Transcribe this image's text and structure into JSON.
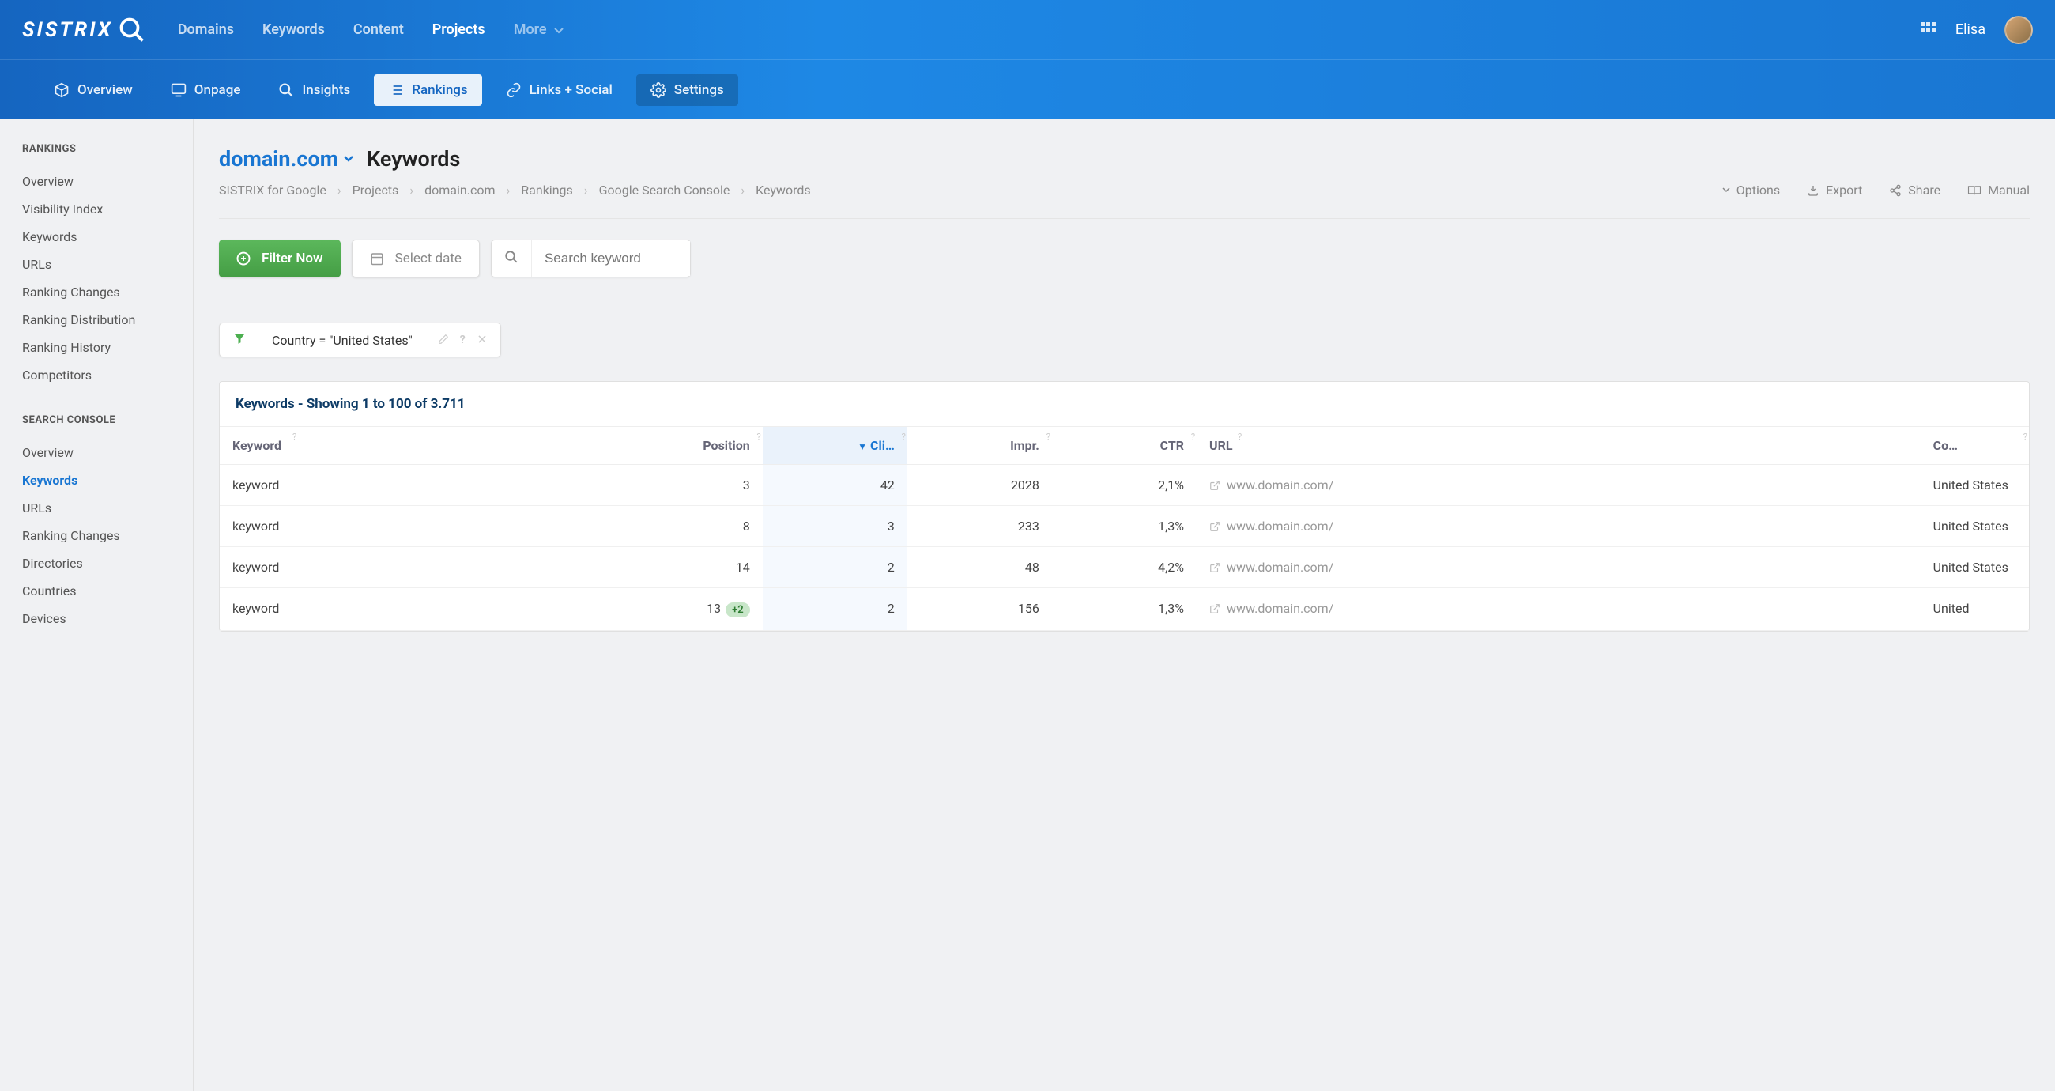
{
  "brand": "SISTRIX",
  "nav": {
    "domains": "Domains",
    "keywords": "Keywords",
    "content": "Content",
    "projects": "Projects",
    "more": "More"
  },
  "user": {
    "name": "Elisa"
  },
  "subnav": {
    "overview": "Overview",
    "onpage": "Onpage",
    "insights": "Insights",
    "rankings": "Rankings",
    "links": "Links + Social",
    "settings": "Settings"
  },
  "sidebar": {
    "rankings_title": "RANKINGS",
    "rankings": [
      "Overview",
      "Visibility Index",
      "Keywords",
      "URLs",
      "Ranking Changes",
      "Ranking Distribution",
      "Ranking History",
      "Competitors"
    ],
    "sc_title": "SEARCH CONSOLE",
    "sc": [
      "Overview",
      "Keywords",
      "URLs",
      "Ranking Changes",
      "Directories",
      "Countries",
      "Devices"
    ]
  },
  "page": {
    "domain": "domain.com",
    "title": "Keywords",
    "crumbs": [
      "SISTRIX for Google",
      "Projects",
      "domain.com",
      "Rankings",
      "Google Search Console",
      "Keywords"
    ],
    "options": "Options",
    "export": "Export",
    "share": "Share",
    "manual": "Manual",
    "filter_btn": "Filter Now",
    "date_btn": "Select date",
    "search_ph": "Search keyword",
    "filter_chip": "Country = \"United States\"",
    "table_title": "Keywords - Showing 1 to 100 of 3.711"
  },
  "columns": {
    "keyword": "Keyword",
    "position": "Position",
    "clicks": "Cli…",
    "impr": "Impr.",
    "ctr": "CTR",
    "url": "URL",
    "country": "Co…"
  },
  "rows": [
    {
      "kw": "keyword",
      "pos": "3",
      "diff": "",
      "clicks": "42",
      "impr": "2028",
      "ctr": "2,1%",
      "url": "www.domain.com/",
      "country": "United States"
    },
    {
      "kw": "keyword",
      "pos": "8",
      "diff": "",
      "clicks": "3",
      "impr": "233",
      "ctr": "1,3%",
      "url": "www.domain.com/",
      "country": "United States"
    },
    {
      "kw": "keyword",
      "pos": "14",
      "diff": "",
      "clicks": "2",
      "impr": "48",
      "ctr": "4,2%",
      "url": "www.domain.com/",
      "country": "United States"
    },
    {
      "kw": "keyword",
      "pos": "13",
      "diff": "+2",
      "clicks": "2",
      "impr": "156",
      "ctr": "1,3%",
      "url": "www.domain.com/",
      "country": "United"
    }
  ]
}
